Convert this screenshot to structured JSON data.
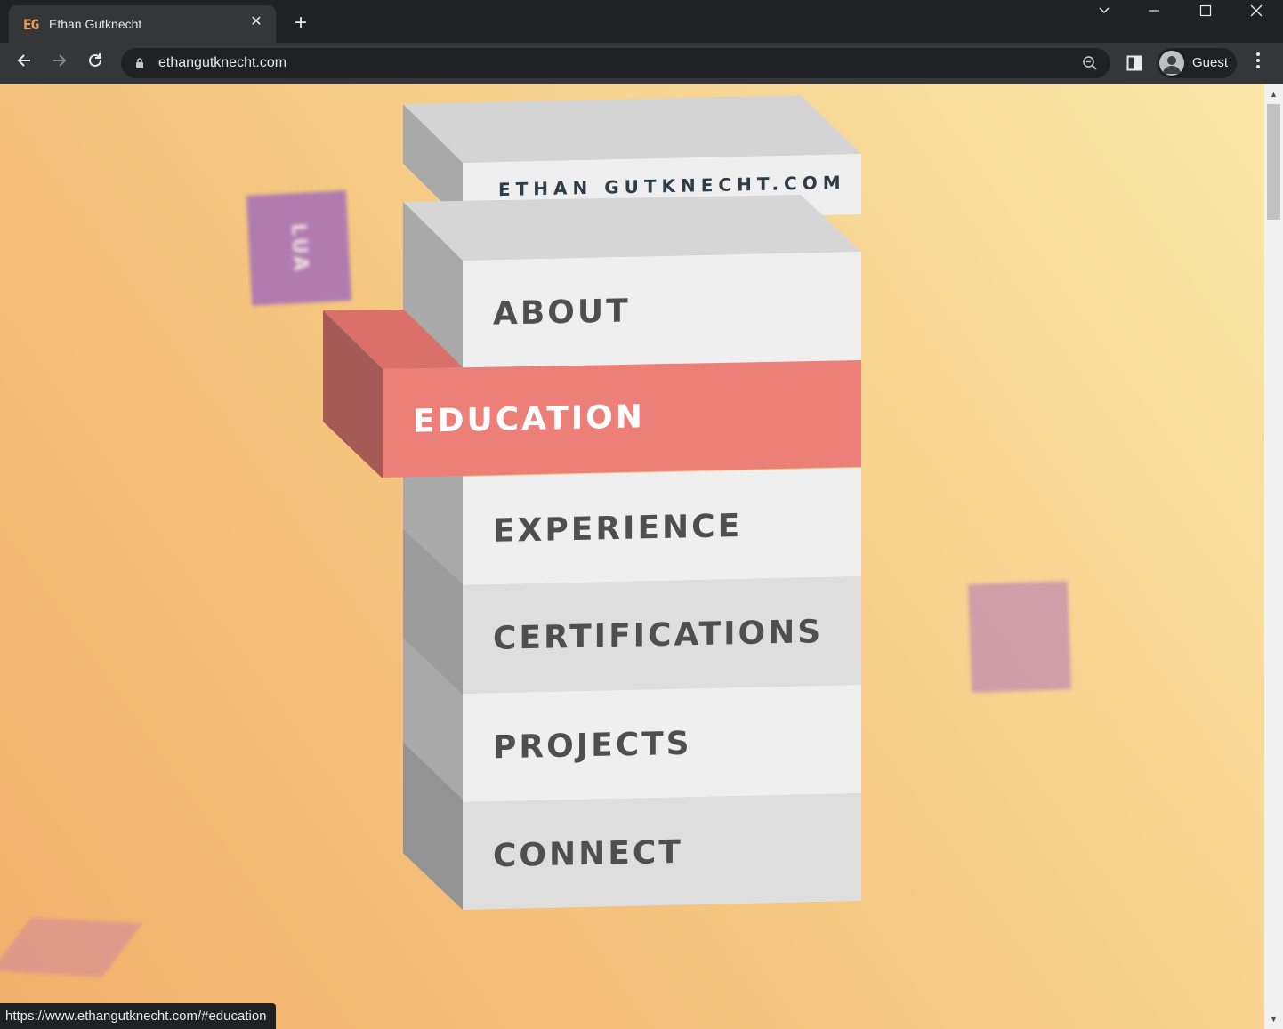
{
  "browser": {
    "tab": {
      "favicon_text": "EG",
      "title": "Ethan Gutknecht"
    },
    "address": {
      "url": "ethangutknecht.com"
    },
    "profile": {
      "label": "Guest"
    },
    "status_url": "https://www.ethangutknecht.com/#education"
  },
  "site": {
    "header": "ETHAN GUTKNECHT.COM",
    "menu": [
      {
        "label": "ABOUT",
        "active": false
      },
      {
        "label": "EDUCATION",
        "active": true
      },
      {
        "label": "EXPERIENCE",
        "active": false
      },
      {
        "label": "CERTIFICATIONS",
        "active": false
      },
      {
        "label": "PROJECTS",
        "active": false
      },
      {
        "label": "CONNECT",
        "active": false
      }
    ],
    "floating_tiles": [
      {
        "label": "LUA",
        "color": "#a56fb8"
      },
      {
        "label": "",
        "color": "#c28cb0"
      },
      {
        "label": "",
        "color": "#d48a9a"
      }
    ]
  },
  "colors": {
    "accent": "#ec7f78",
    "accent_side": "#a65a55",
    "accent_top": "#d9706a"
  }
}
